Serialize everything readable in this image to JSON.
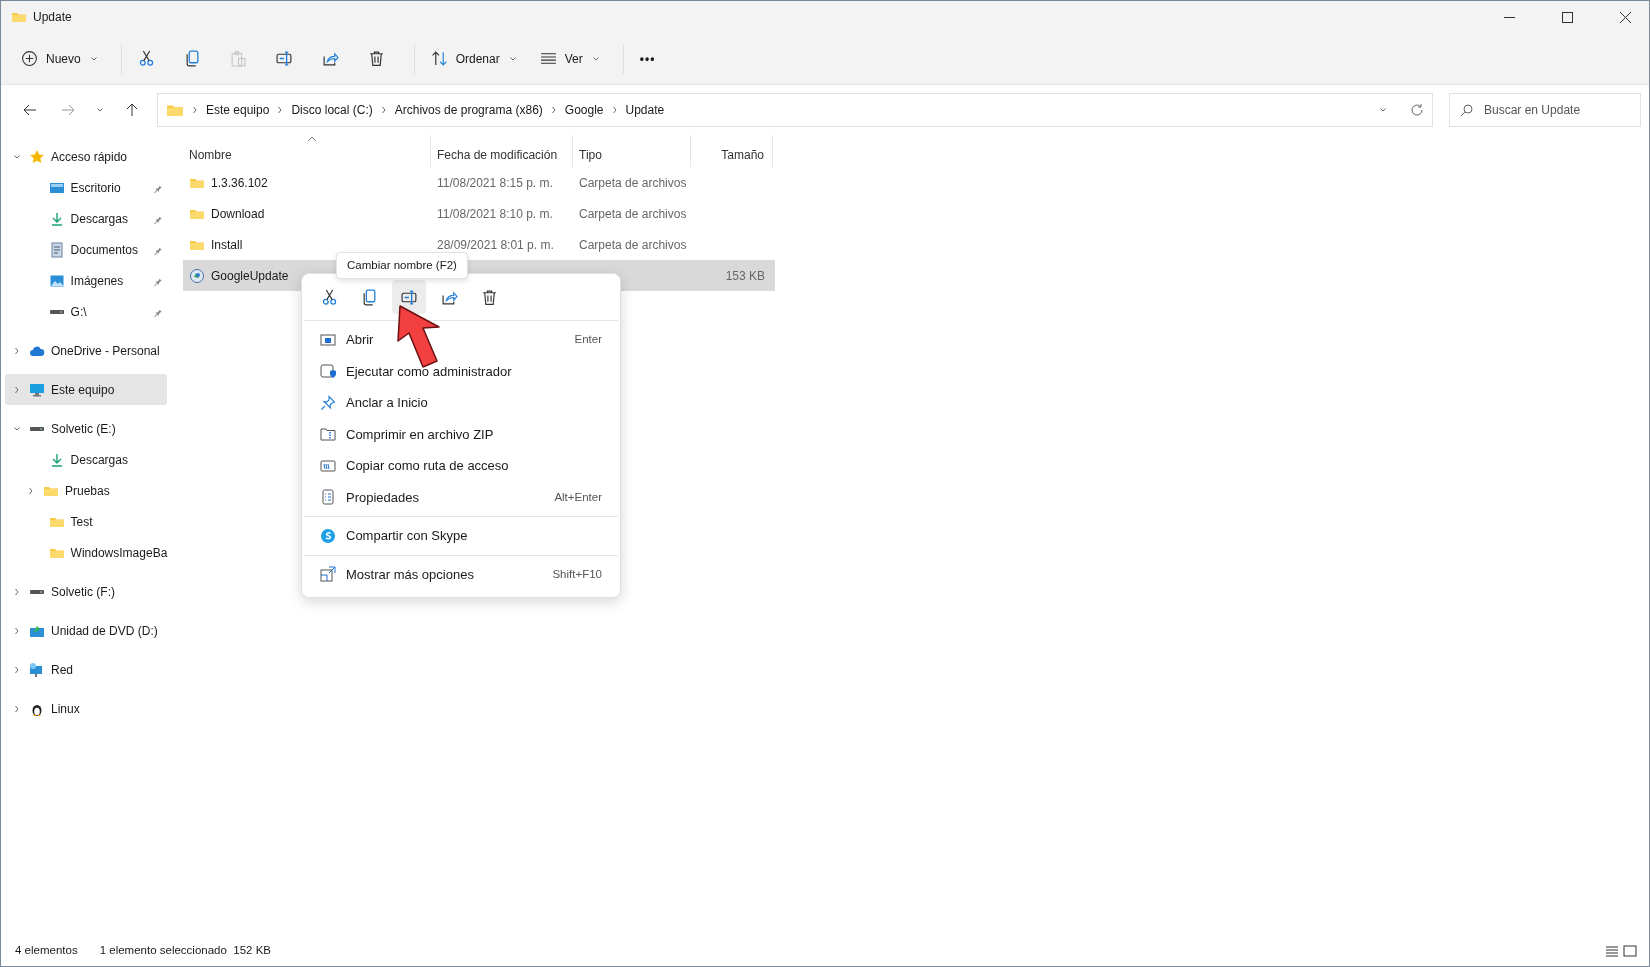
{
  "window": {
    "title": "Update"
  },
  "toolbar": [
    {
      "kind": "new",
      "label": "Nuevo",
      "disabled": false
    },
    {
      "kind": "cut",
      "disabled": false
    },
    {
      "kind": "copy",
      "disabled": false
    },
    {
      "kind": "paste",
      "disabled": true
    },
    {
      "kind": "rename",
      "disabled": false
    },
    {
      "kind": "share",
      "disabled": false
    },
    {
      "kind": "delete",
      "disabled": false
    },
    {
      "kind": "sort",
      "label": "Ordenar",
      "disabled": false
    },
    {
      "kind": "view",
      "label": "Ver",
      "disabled": false
    },
    {
      "kind": "more",
      "label": "•••",
      "disabled": false
    }
  ],
  "breadcrumb": [
    "Este equipo",
    "Disco local (C:)",
    "Archivos de programa (x86)",
    "Google",
    "Update"
  ],
  "search": {
    "placeholder": "Buscar en Update"
  },
  "sidebar": [
    {
      "kind": "star",
      "label": "Acceso rápido",
      "expanded": true,
      "selected": false,
      "children": [
        {
          "kind": "desktop",
          "label": "Escritorio",
          "pinned": true,
          "selected": false
        },
        {
          "kind": "download",
          "label": "Descargas",
          "pinned": true,
          "selected": false
        },
        {
          "kind": "document",
          "label": "Documentos",
          "pinned": true,
          "selected": false
        },
        {
          "kind": "image",
          "label": "Imágenes",
          "pinned": true,
          "selected": false
        },
        {
          "kind": "drive",
          "label": "G:\\",
          "pinned": true,
          "selected": false
        }
      ]
    },
    {
      "kind": "cloud",
      "label": "OneDrive - Personal",
      "expanded": false,
      "selected": false
    },
    {
      "kind": "pc",
      "label": "Este equipo",
      "expanded": false,
      "selected": true
    },
    {
      "kind": "drive",
      "label": "Solvetic (E:)",
      "expanded": true,
      "selected": false,
      "children": [
        {
          "kind": "download",
          "label": "Descargas",
          "selected": false
        },
        {
          "kind": "folder",
          "label": "Pruebas",
          "expanded": false,
          "selected": false
        },
        {
          "kind": "folder",
          "label": "Test",
          "selected": false
        },
        {
          "kind": "folder",
          "label": "WindowsImageBa",
          "selected": false
        }
      ]
    },
    {
      "kind": "drive",
      "label": "Solvetic (F:)",
      "expanded": false,
      "selected": false
    },
    {
      "kind": "dvd",
      "label": "Unidad de DVD (D:)",
      "expanded": false,
      "selected": false
    },
    {
      "kind": "network",
      "label": "Red",
      "expanded": false,
      "selected": false
    },
    {
      "kind": "penguin",
      "label": "Linux",
      "expanded": false,
      "selected": false
    }
  ],
  "table": {
    "columns": [
      {
        "label": "Nombre",
        "sorted": true
      },
      {
        "label": "Fecha de modificación",
        "sorted": false
      },
      {
        "label": "Tipo",
        "sorted": false
      },
      {
        "label": "Tamaño",
        "sorted": false
      }
    ],
    "rows": [
      {
        "kind": "folder",
        "name": "1.3.36.102",
        "modified": "11/08/2021 8:15 p. m.",
        "type": "Carpeta de archivos",
        "size": "",
        "selected": false
      },
      {
        "kind": "folder",
        "name": "Download",
        "modified": "11/08/2021 8:10 p. m.",
        "type": "Carpeta de archivos",
        "size": "",
        "selected": false
      },
      {
        "kind": "folder",
        "name": "Install",
        "modified": "28/09/2021 8:01 p. m.",
        "type": "Carpeta de archivos",
        "size": "",
        "selected": false
      },
      {
        "kind": "app",
        "name": "GoogleUpdate",
        "modified": "",
        "type": "",
        "size": "153 KB",
        "selected": true
      }
    ]
  },
  "tooltip": "Cambiar nombre (F2)",
  "context_menu": {
    "actions": [
      {
        "kind": "cut",
        "hovered": false
      },
      {
        "kind": "copy",
        "hovered": false
      },
      {
        "kind": "rename",
        "hovered": true
      },
      {
        "kind": "share",
        "hovered": false
      },
      {
        "kind": "delete",
        "hovered": false
      }
    ],
    "sections": [
      [
        {
          "kind": "open",
          "label": "Abrir",
          "shortcut": "Enter"
        },
        {
          "kind": "admin",
          "label": "Ejecutar como administrador"
        },
        {
          "kind": "pin",
          "label": "Anclar a Inicio"
        },
        {
          "kind": "zip",
          "label": "Comprimir en archivo ZIP"
        },
        {
          "kind": "path",
          "label": "Copiar como ruta de acceso"
        },
        {
          "kind": "props",
          "label": "Propiedades",
          "shortcut": "Alt+Enter"
        }
      ],
      [
        {
          "kind": "skype",
          "label": "Compartir con Skype"
        }
      ],
      [
        {
          "kind": "moreopts",
          "label": "Mostrar más opciones",
          "shortcut": "Shift+F10"
        }
      ]
    ]
  },
  "status_bar": {
    "count": "4 elementos",
    "selection": "1 elemento seleccionado  152 KB"
  }
}
